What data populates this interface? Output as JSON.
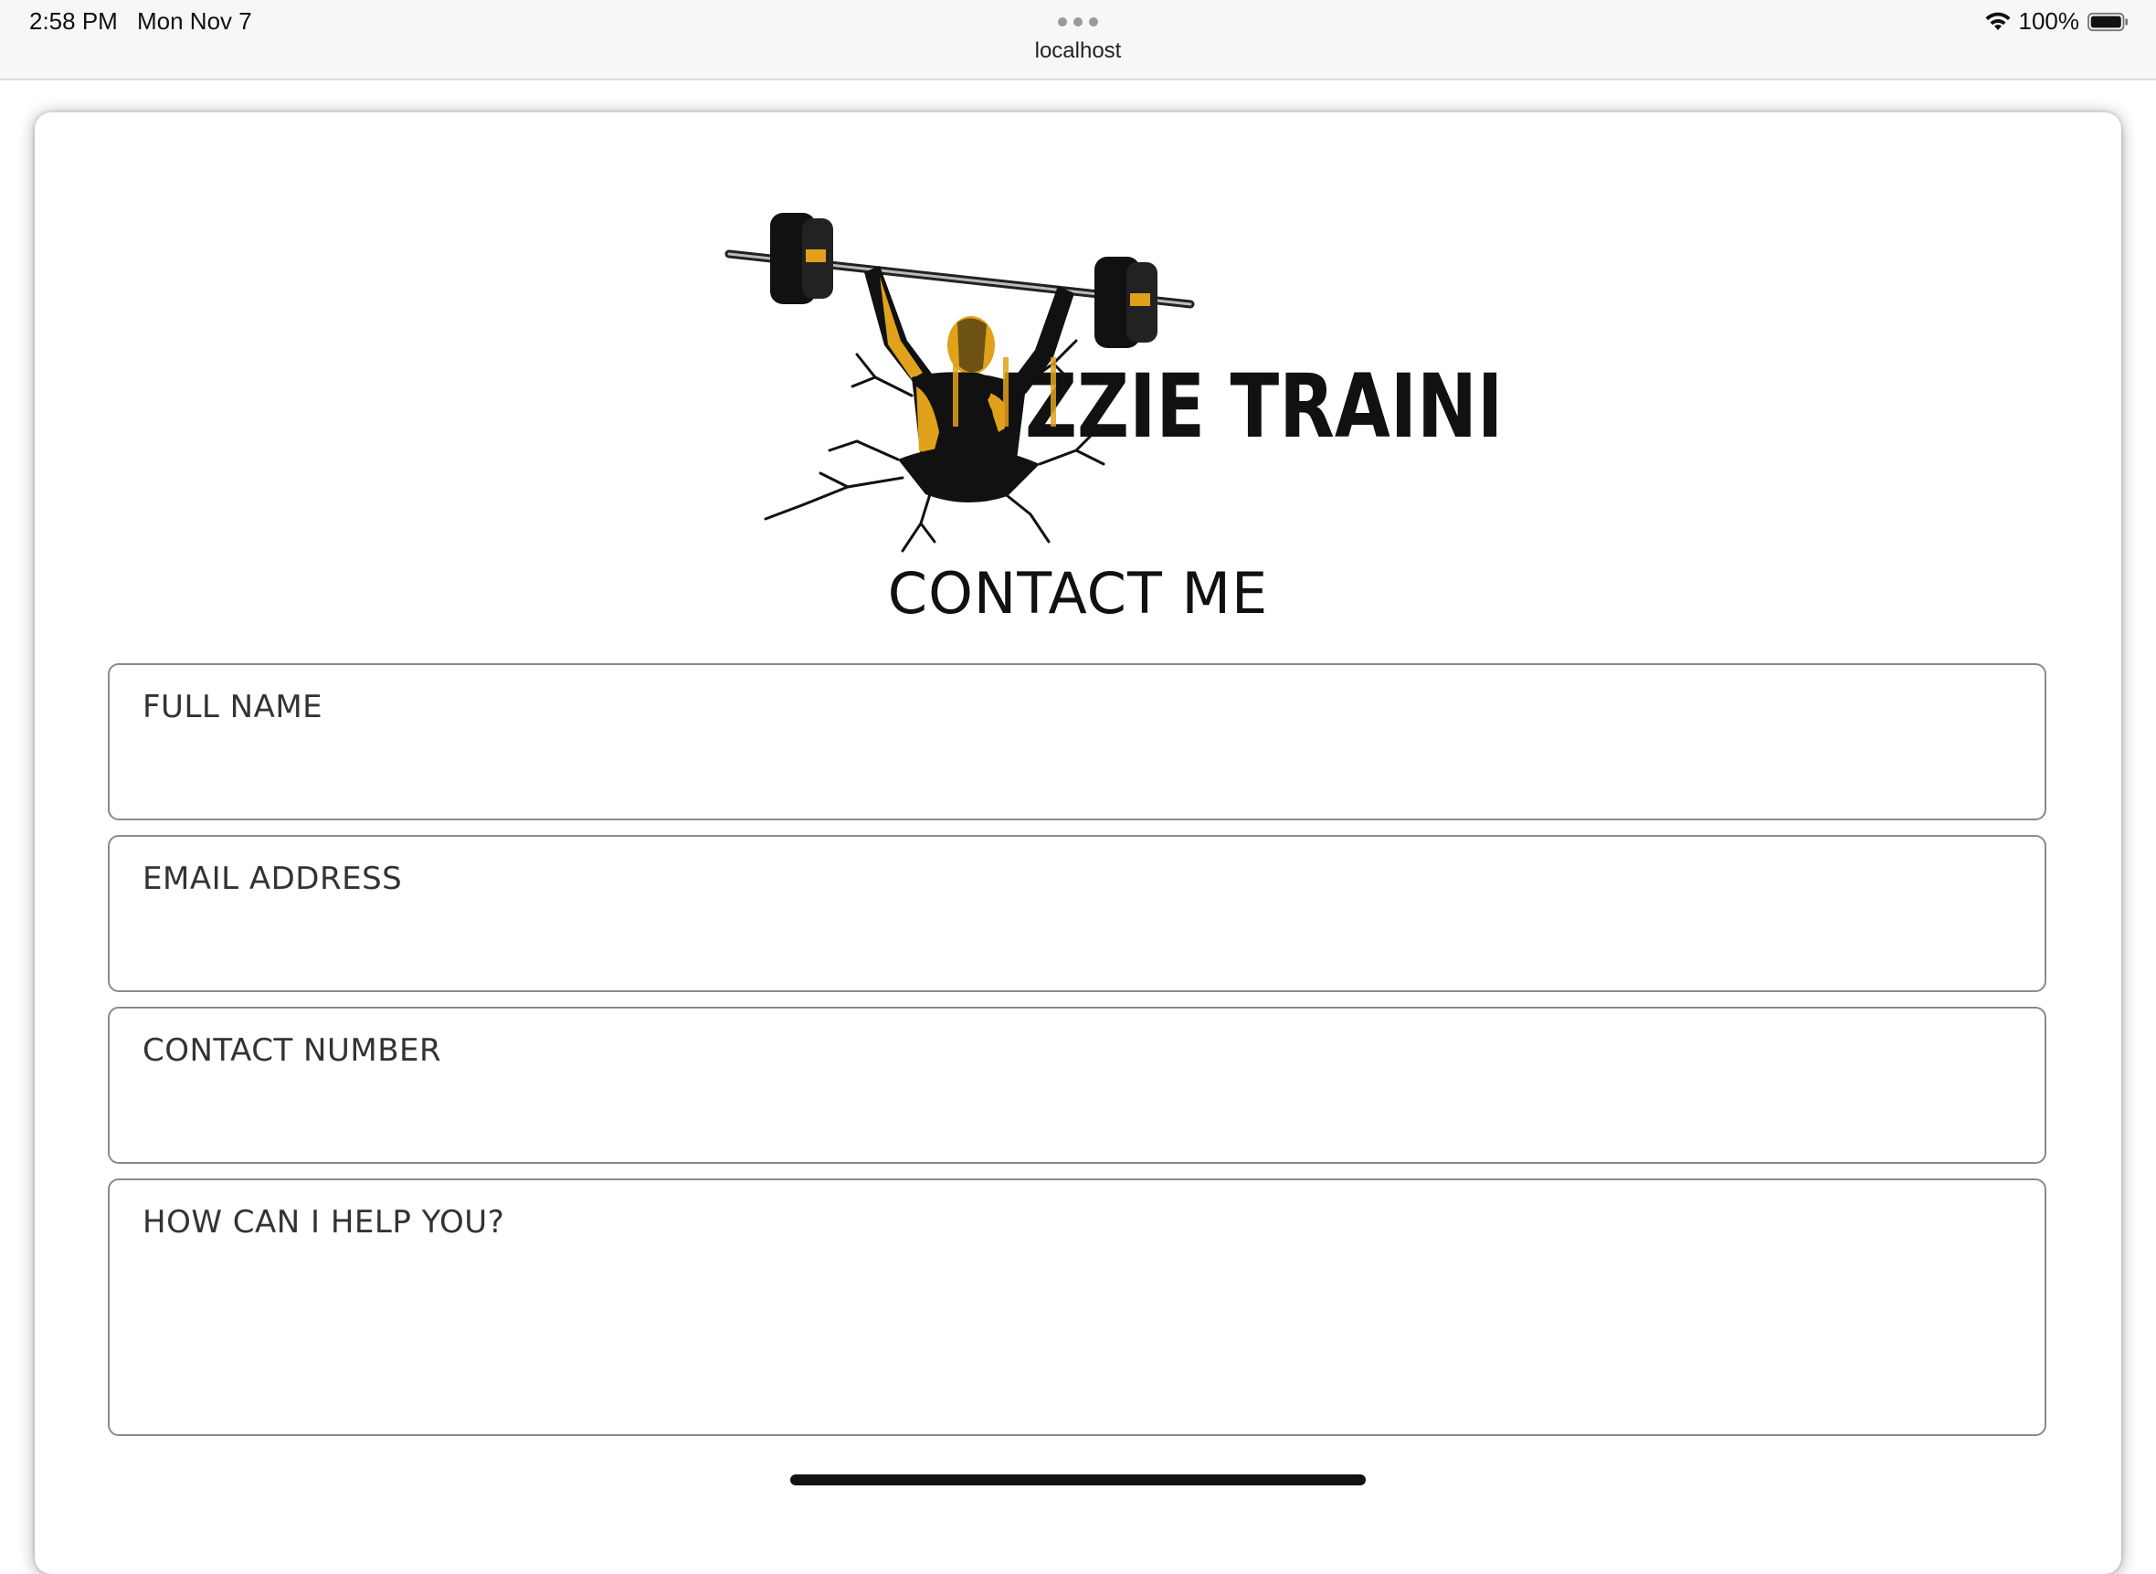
{
  "status_bar": {
    "time": "2:58 PM",
    "date": "Mon Nov 7",
    "url": "localhost",
    "battery": "100%"
  },
  "logo": {
    "text": "BIZZIE TRAINER",
    "accent_color": "#E0A11B"
  },
  "page": {
    "title": "CONTACT ME"
  },
  "form": {
    "full_name_placeholder": "FULL NAME",
    "email_placeholder": "EMAIL ADDRESS",
    "contact_number_placeholder": "CONTACT NUMBER",
    "message_placeholder": "HOW CAN I HELP YOU?"
  },
  "icons": {
    "wifi": "wifi-icon",
    "battery": "battery-icon",
    "more": "more-dots-icon"
  }
}
